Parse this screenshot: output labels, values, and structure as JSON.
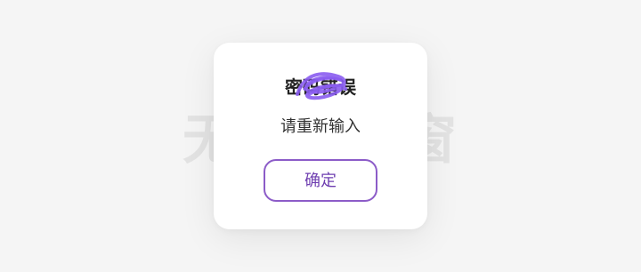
{
  "background": {
    "watermark_text": "无标题弹窗"
  },
  "dialog": {
    "title": "密码错误",
    "message": "请重新输入",
    "confirm_label": "确定"
  },
  "colors": {
    "accent": "#8c5cc8",
    "scribble": "#8a5cf0",
    "page_background": "#f5f5f5",
    "watermark": "#e3e3e3"
  }
}
